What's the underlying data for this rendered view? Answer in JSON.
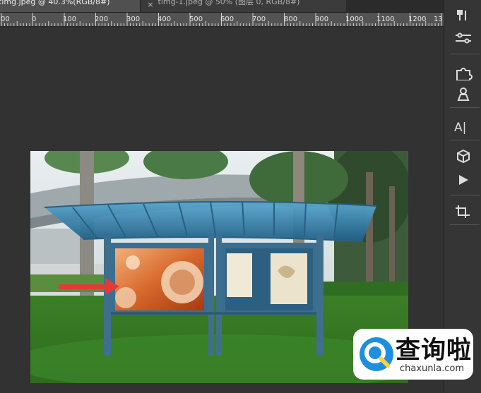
{
  "tabs": [
    {
      "label": "timg.jpeg @ 40.3%(RGB/8#) ˅",
      "active": true
    },
    {
      "label": "timg-1.jpeg @ 50% (图层 0, RGB/8#) ˅",
      "active": false
    }
  ],
  "tab_close_glyph": "×",
  "ruler": {
    "labels": [
      "00",
      "0",
      "100",
      "200",
      "300",
      "400",
      "500",
      "600",
      "700",
      "800",
      "900",
      "1000",
      "1100",
      "1200",
      "13"
    ]
  },
  "panel": {
    "tools": [
      {
        "icon": "brush-settings-icon"
      },
      {
        "icon": "adjustments-sliders-icon"
      },
      {
        "icon": "puzzle-plugin-icon"
      },
      {
        "icon": "clone-stamp-icon"
      },
      {
        "icon": "character-text-icon",
        "text": "A|"
      },
      {
        "icon": "3d-cube-icon"
      },
      {
        "icon": "play-action-icon"
      },
      {
        "icon": "crop-icon"
      }
    ]
  },
  "watermark": {
    "title": "查询啦",
    "url": "chaxunla.com",
    "accent": "#1e8fe0"
  },
  "colors": {
    "arrow": "#e23b36",
    "canopy": "#2b79a8",
    "grass": "#3f8a2a"
  }
}
